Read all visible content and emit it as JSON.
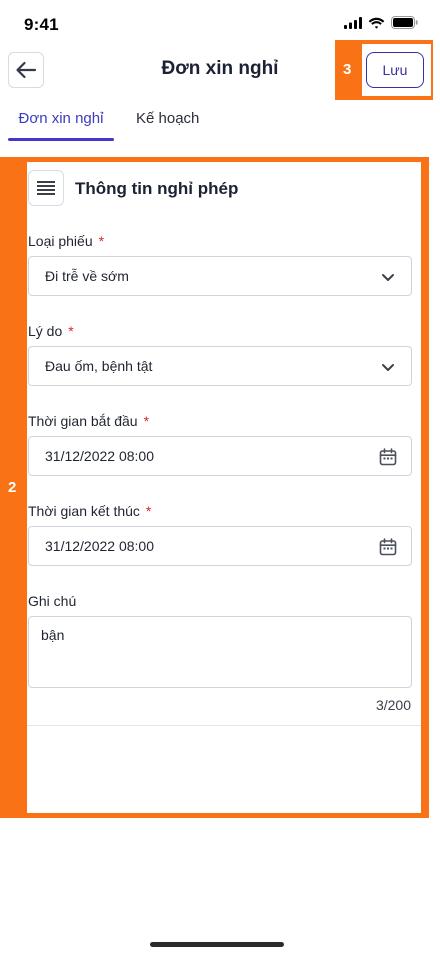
{
  "status_bar": {
    "time": "9:41"
  },
  "header": {
    "title": "Đơn xin nghỉ",
    "save_label": "Lưu"
  },
  "tabs": [
    {
      "label": "Đơn xin nghỉ",
      "active": true
    },
    {
      "label": "Kế hoạch",
      "active": false
    }
  ],
  "overlays": {
    "form_number": "2",
    "save_number": "3"
  },
  "section": {
    "title": "Thông tin nghỉ phép"
  },
  "fields": {
    "leave_type": {
      "label": "Loại phiếu",
      "required_mark": "*",
      "value": "Đi trễ về sớm",
      "icon": "chevron-down-icon"
    },
    "reason": {
      "label": "Lý do",
      "required_mark": "*",
      "value": "Đau ốm, bệnh tật",
      "icon": "chevron-down-icon"
    },
    "start_time": {
      "label": "Thời gian bắt đầu",
      "required_mark": "*",
      "value": "31/12/2022 08:00",
      "icon": "calendar-icon"
    },
    "end_time": {
      "label": "Thời gian kết thúc",
      "required_mark": "*",
      "value": "31/12/2022 08:00",
      "icon": "calendar-icon"
    },
    "note": {
      "label": "Ghi chú",
      "value": "bận",
      "char_count": "3/200"
    }
  },
  "colors": {
    "accent": "#3730a3",
    "tab_underline": "#4338ca",
    "overlay": "#f97316",
    "required": "#dc2626"
  }
}
